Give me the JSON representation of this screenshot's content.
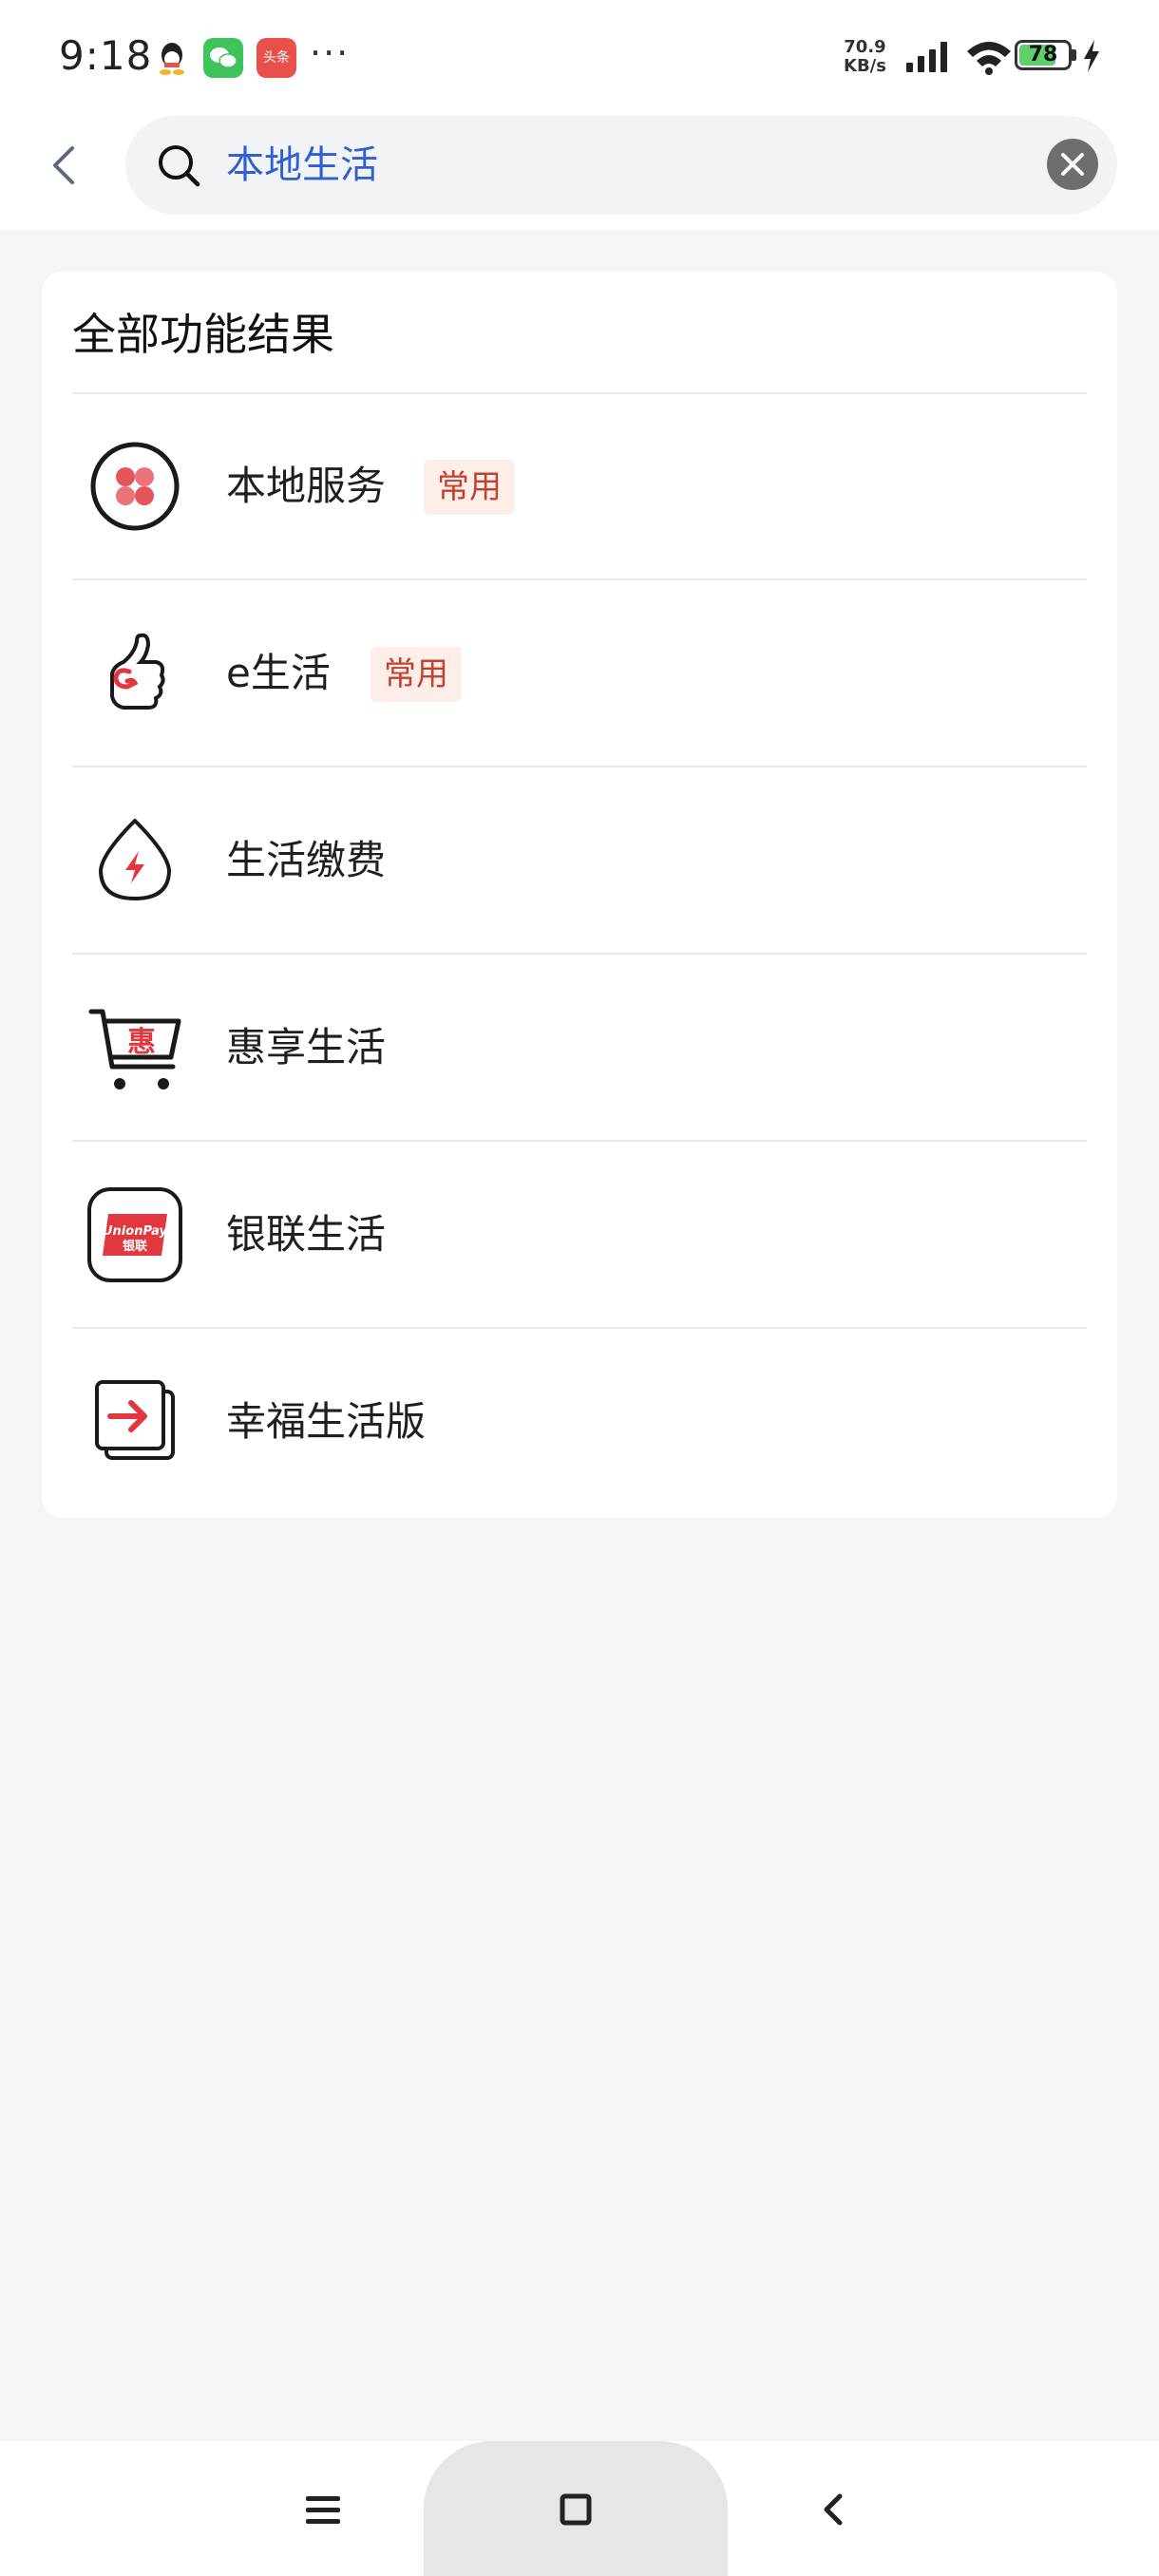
{
  "status_bar": {
    "time": "9:18",
    "net_speed_value": "70.9",
    "net_speed_unit": "KB/s",
    "battery_level": "78",
    "notifications": [
      "qq-icon",
      "wechat-icon",
      "toutiao-icon"
    ],
    "toutiao_label": "头条",
    "more": "···"
  },
  "header": {
    "search_value": "本地生活"
  },
  "results": {
    "title": "全部功能结果",
    "items": [
      {
        "label": "本地服务",
        "badge": "常用",
        "icon": "local-service-icon"
      },
      {
        "label": "e生活",
        "badge": "常用",
        "icon": "thumbs-up-icon"
      },
      {
        "label": "生活缴费",
        "badge": "",
        "icon": "utility-payment-icon"
      },
      {
        "label": "惠享生活",
        "badge": "",
        "icon": "shopping-cart-icon"
      },
      {
        "label": "银联生活",
        "badge": "",
        "icon": "unionpay-icon"
      },
      {
        "label": "幸福生活版",
        "badge": "",
        "icon": "switch-version-icon"
      }
    ],
    "cart_icon_text": "惠",
    "unionpay_text": "UnionPay",
    "unionpay_cn": "银联"
  },
  "colors": {
    "accent_text": "#2f5fd0",
    "badge_text": "#c2422e",
    "badge_bg": "#fdeeea",
    "icon_red": "#e0383e"
  }
}
